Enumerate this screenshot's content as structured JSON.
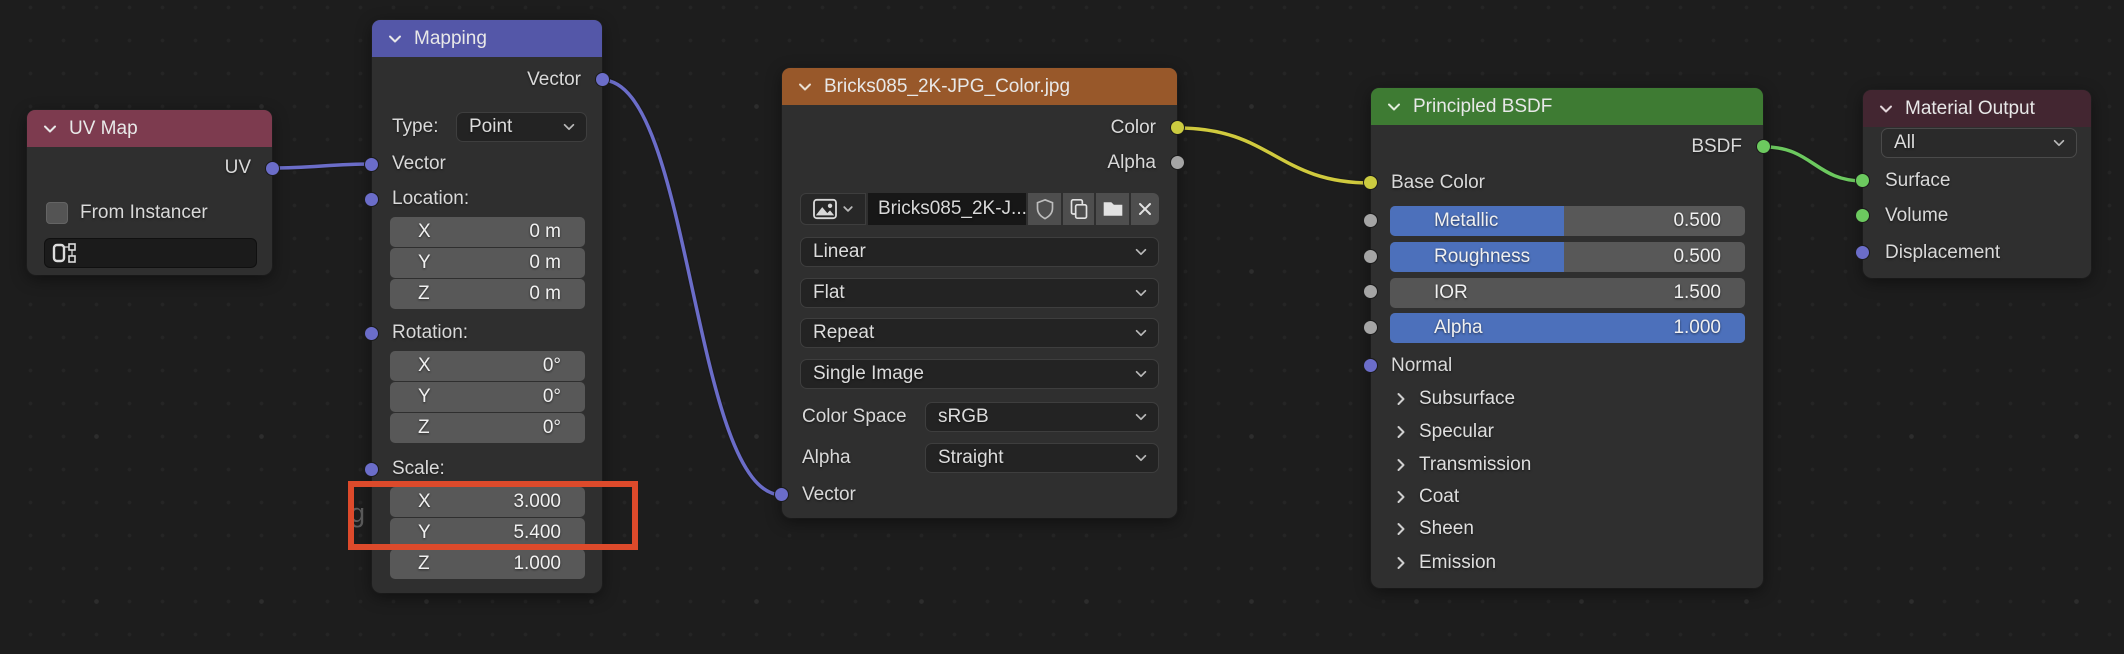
{
  "annotation": {
    "color": "#dd4a2b",
    "artifact_text": "g"
  },
  "colors": {
    "background": "#1d1d1d",
    "node_body": "#2f2f2f",
    "headers": {
      "uv_map": "#7d3b4f",
      "mapping": "#5457a8",
      "image_texture": "#98582a",
      "principled": "#3e7b33",
      "material_output": "#432631"
    },
    "sockets": {
      "vector": "#6b6dc9",
      "color": "#cbcb40",
      "gray": "#a5a5a5",
      "shader": "#6cc95f"
    },
    "wires": {
      "vector": "#6b6dc9",
      "color": "#d0ca3e",
      "shader": "#6cc95f"
    },
    "slider_fill": "#4c70bb"
  },
  "nodes": {
    "uv_map": {
      "title": "UV Map",
      "output_label": "UV",
      "checkbox_label": "From Instancer",
      "uv_field_value": ""
    },
    "mapping": {
      "title": "Mapping",
      "output_label": "Vector",
      "type_label": "Type:",
      "type_value": "Point",
      "input_vector_label": "Vector",
      "location": {
        "label": "Location:",
        "rows": [
          {
            "axis": "X",
            "value": "0 m"
          },
          {
            "axis": "Y",
            "value": "0 m"
          },
          {
            "axis": "Z",
            "value": "0 m"
          }
        ]
      },
      "rotation": {
        "label": "Rotation:",
        "rows": [
          {
            "axis": "X",
            "value": "0°"
          },
          {
            "axis": "Y",
            "value": "0°"
          },
          {
            "axis": "Z",
            "value": "0°"
          }
        ]
      },
      "scale": {
        "label": "Scale:",
        "rows": [
          {
            "axis": "X",
            "value": "3.000"
          },
          {
            "axis": "Y",
            "value": "5.400"
          },
          {
            "axis": "Z",
            "value": "1.000"
          }
        ]
      }
    },
    "image_texture": {
      "title": "Bricks085_2K-JPG_Color.jpg",
      "outputs": [
        {
          "label": "Color"
        },
        {
          "label": "Alpha"
        }
      ],
      "image_name": "Bricks085_2K-J...",
      "interpolation": "Linear",
      "projection": "Flat",
      "extension": "Repeat",
      "source": "Single Image",
      "color_space_label": "Color Space",
      "color_space_value": "sRGB",
      "alpha_label": "Alpha",
      "alpha_value": "Straight",
      "input_vector_label": "Vector"
    },
    "principled": {
      "title": "Principled BSDF",
      "output_label": "BSDF",
      "base_color_label": "Base Color",
      "sliders": [
        {
          "label": "Metallic",
          "value": "0.500",
          "fill_pct": "49%"
        },
        {
          "label": "Roughness",
          "value": "0.500",
          "fill_pct": "49%"
        },
        {
          "label": "IOR",
          "value": "1.500",
          "fill_pct": "0%"
        },
        {
          "label": "Alpha",
          "value": "1.000",
          "fill_pct": "100%"
        }
      ],
      "normal_label": "Normal",
      "panels": [
        {
          "label": "Subsurface"
        },
        {
          "label": "Specular"
        },
        {
          "label": "Transmission"
        },
        {
          "label": "Coat"
        },
        {
          "label": "Sheen"
        },
        {
          "label": "Emission"
        }
      ]
    },
    "material_output": {
      "title": "Material Output",
      "target_value": "All",
      "inputs": [
        {
          "label": "Surface"
        },
        {
          "label": "Volume"
        },
        {
          "label": "Displacement"
        }
      ]
    }
  }
}
